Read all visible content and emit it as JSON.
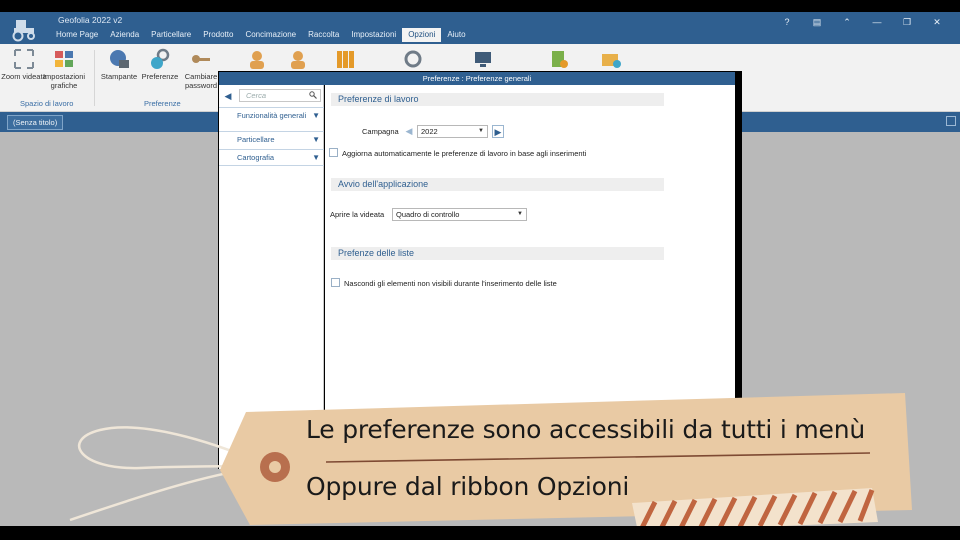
{
  "app": {
    "title": "Geofolia 2022 v2",
    "menu": [
      "Home Page",
      "Azienda",
      "Particellare",
      "Prodotto",
      "Concimazione",
      "Raccolta",
      "Impostazioni",
      "Opzioni",
      "Aiuto"
    ],
    "active_menu": "Opzioni",
    "window_controls": [
      "?",
      "▤",
      "⌃",
      "—",
      "❐",
      "✕"
    ]
  },
  "ribbon": {
    "buttons": [
      {
        "label": "Zoom videata",
        "icon": "zoom-icon"
      },
      {
        "label": "Impostazioni grafiche",
        "icon": "graphic-settings-icon"
      },
      {
        "label": "Stampante",
        "icon": "printer-icon"
      },
      {
        "label": "Preferenze",
        "icon": "preferences-gear-icon"
      },
      {
        "label": "Cambiare password",
        "icon": "key-icon"
      }
    ],
    "groups": [
      "Spazio di lavoro",
      "Preferenze"
    ]
  },
  "docbar": {
    "tab": "(Senza titolo)"
  },
  "dialog": {
    "title": "Preferenze : Preferenze generali",
    "search_placeholder": "Cerca",
    "nav": [
      "Funzionalità generali",
      "Particellare",
      "Cartografia"
    ],
    "sections": {
      "work": "Preferenze di lavoro",
      "startup": "Avvio dell'applicazione",
      "lists": "Prefenze delle liste"
    },
    "campaign_label": "Campagna",
    "campaign_value": "2022",
    "auto_update_label": "Aggiorna automaticamente le preferenze di lavoro in base agli inserimenti",
    "open_view_label": "Aprire la videata",
    "open_view_value": "Quadro di controllo",
    "hide_elements_label": "Nascondi gli elementi non visibili durante l'inserimento delle liste"
  },
  "caption": {
    "line1": "Le preferenze sono accessibili da tutti i menù",
    "line2": "Oppure dal ribbon Opzioni"
  },
  "colors": {
    "accent": "#2f5f90",
    "workspace": "#b9b9b9",
    "tag": "#e8c9a4"
  }
}
